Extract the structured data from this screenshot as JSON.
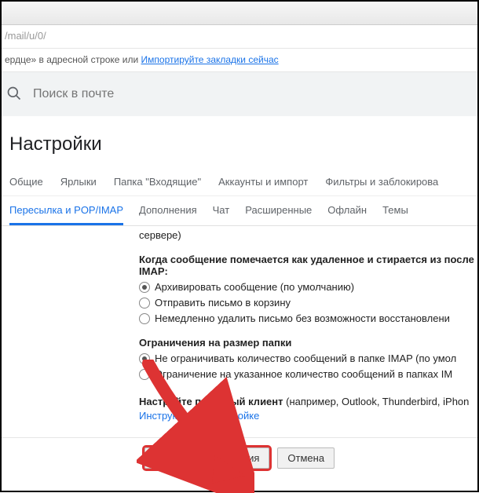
{
  "browser": {
    "url_fragment": "/mail/u/0/",
    "bookmark_hint_prefix": "ердце» в адресной строке или ",
    "bookmark_link": "Импортируйте закладки сейчас"
  },
  "search": {
    "placeholder": "Поиск в почте"
  },
  "page": {
    "title": "Настройки"
  },
  "tabs_row1": {
    "general": "Общие",
    "labels": "Ярлыки",
    "inbox": "Папка \"Входящие\"",
    "accounts": "Аккаунты и импорт",
    "filters": "Фильтры и заблокирова"
  },
  "tabs_row2": {
    "fwd_pop_imap": "Пересылка и POP/IMAP",
    "addons": "Дополнения",
    "chat": "Чат",
    "advanced": "Расширенные",
    "offline": "Офлайн",
    "themes": "Темы"
  },
  "content": {
    "server_snippet": "сервере)",
    "deleted_heading": "Когда сообщение помечается как удаленное и стирается из после\nIMAP:",
    "opt_archive": "Архивировать сообщение (по умолчанию)",
    "opt_trash": "Отправить письмо в корзину",
    "opt_delete_now": "Немедленно удалить письмо без возможности восстановлени",
    "folder_limit_heading": "Ограничения на размер папки",
    "opt_no_limit": "Не ограничивать количество сообщений в папке IMAP (по умол",
    "opt_limit": "Ограничение на указанное количество сообщений в папках IM",
    "client_heading": "Настройте почтовый клиент",
    "client_examples": " (например, Outlook, Thunderbird, iPhon",
    "client_instructions": "Инструкции по настройке"
  },
  "footer": {
    "save": "Сохранить изменения",
    "cancel": "Отмена"
  }
}
